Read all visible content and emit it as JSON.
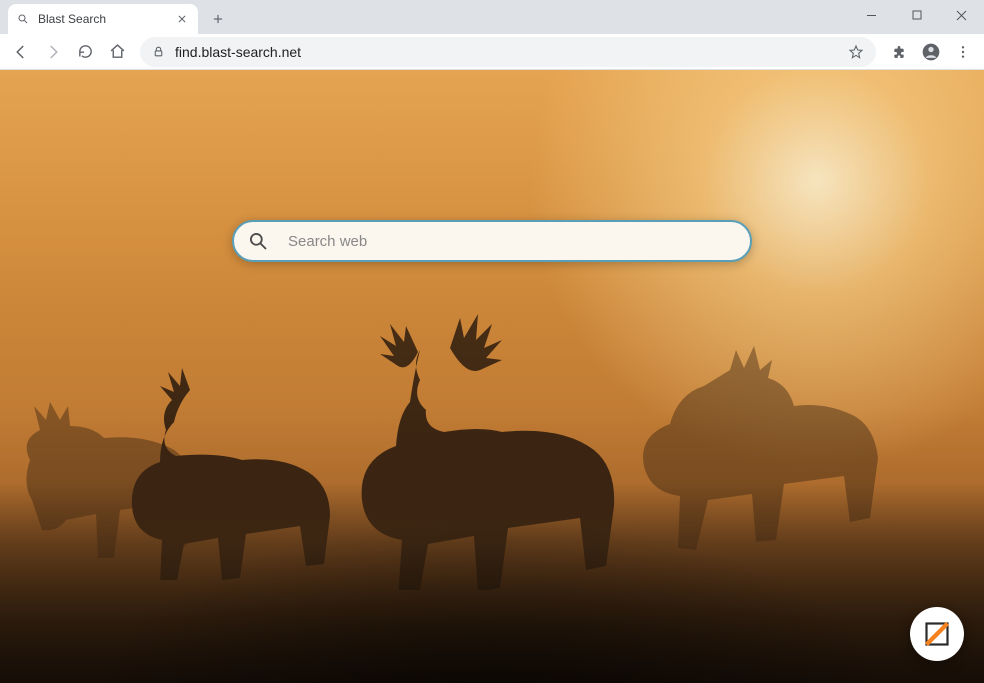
{
  "window": {
    "tab_title": "Blast Search",
    "url": "find.blast-search.net"
  },
  "search": {
    "placeholder": "Search web",
    "value": ""
  },
  "icons": {
    "tab_favicon": "search-icon",
    "float_button": "edit-icon"
  },
  "colors": {
    "search_border": "#5a9fb8",
    "bg_warm": "#d68f3e"
  }
}
